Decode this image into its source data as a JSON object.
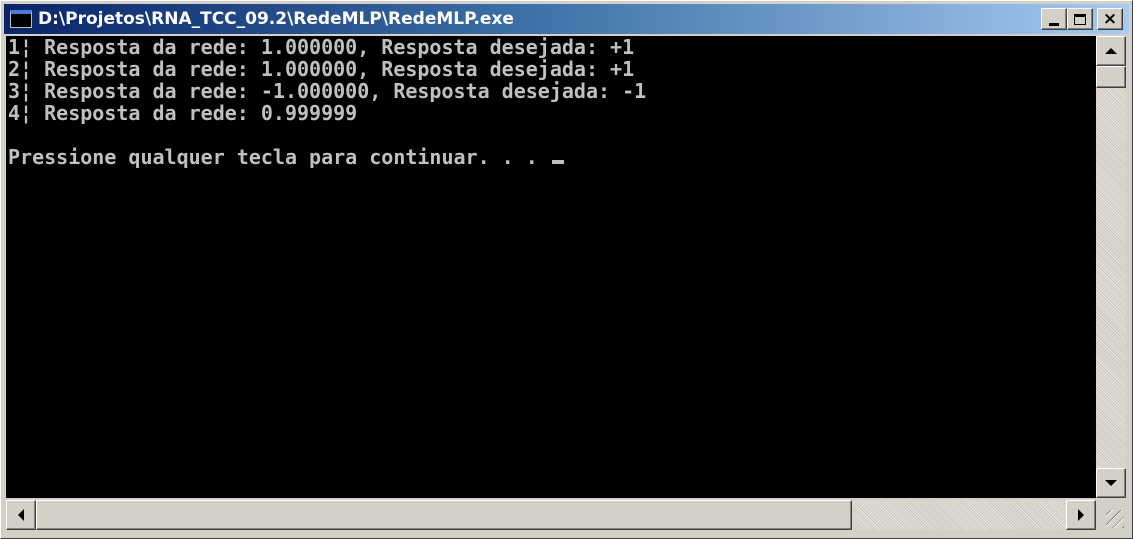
{
  "window": {
    "title": "D:\\Projetos\\RNA_TCC_09.2\\RedeMLP\\RedeMLP.exe",
    "icon": "console-app-icon",
    "controls": {
      "minimize": "minimize-icon",
      "maximize": "maximize-icon",
      "close": "×"
    }
  },
  "console": {
    "lines": [
      "1¦ Resposta da rede: 1.000000, Resposta desejada: +1",
      "2¦ Resposta da rede: 1.000000, Resposta desejada: +1",
      "3¦ Resposta da rede: -1.000000, Resposta desejada: -1",
      "4¦ Resposta da rede: 0.999999",
      "",
      "Pressione qualquer tecla para continuar. . . "
    ],
    "text_color": "#c0c0c0",
    "background_color": "#000000"
  },
  "colors": {
    "titlebar_start": "#0a246a",
    "titlebar_end": "#a6caf0",
    "chrome": "#d4d0c8"
  }
}
